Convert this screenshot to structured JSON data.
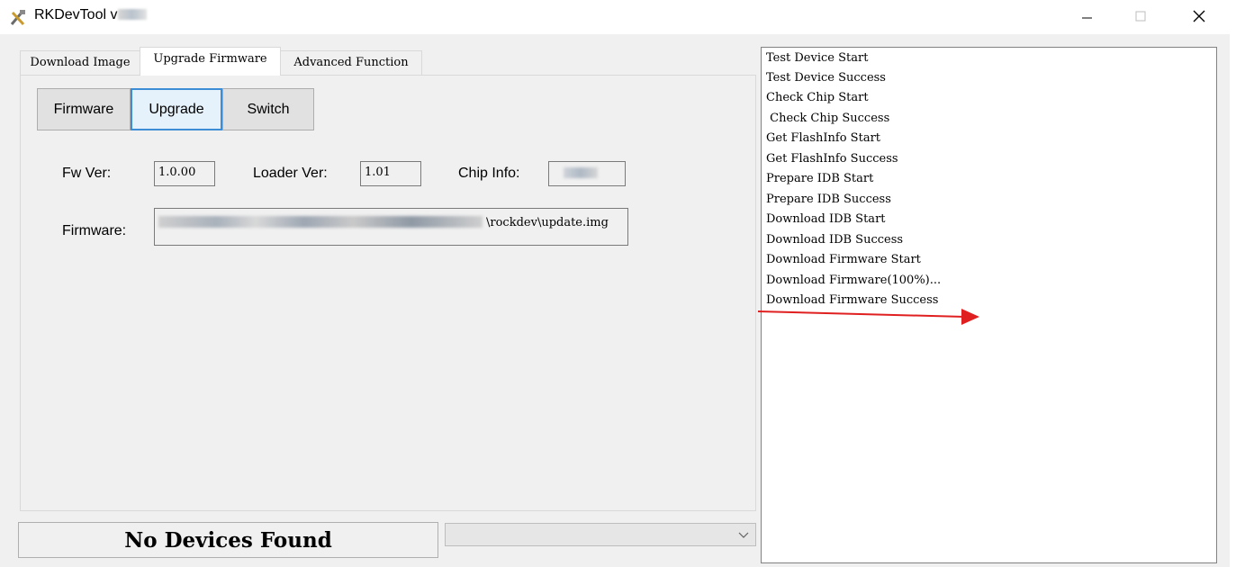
{
  "window": {
    "title": "RKDevTool v",
    "colors": {
      "close_x": "#000000",
      "accent_focus": "#3c8dd6"
    }
  },
  "tabs": [
    {
      "label": "Download Image",
      "active": false
    },
    {
      "label": "Upgrade Firmware",
      "active": true
    },
    {
      "label": "Advanced Function",
      "active": false
    }
  ],
  "buttons": {
    "firmware": "Firmware",
    "upgrade": "Upgrade",
    "switch": "Switch"
  },
  "info": {
    "fw_ver_label": "Fw Ver:",
    "fw_ver_value": "1.0.00",
    "loader_ver_label": "Loader Ver:",
    "loader_ver_value": "1.01",
    "chip_info_label": "Chip Info:",
    "firmware_label": "Firmware:",
    "firmware_path_visible": "\\rockdev\\update.img"
  },
  "status": {
    "text": "No Devices Found"
  },
  "log": [
    "Test Device Start",
    "Test Device Success",
    "Check Chip Start",
    " Check Chip Success",
    "Get FlashInfo Start",
    "Get FlashInfo Success",
    "Prepare IDB Start",
    "Prepare IDB Success",
    "Download IDB Start",
    "Download IDB Success",
    "Download Firmware Start",
    "Download Firmware(100%)...",
    "Download Firmware Success"
  ],
  "annotation": {
    "arrow_color": "#e02020"
  }
}
